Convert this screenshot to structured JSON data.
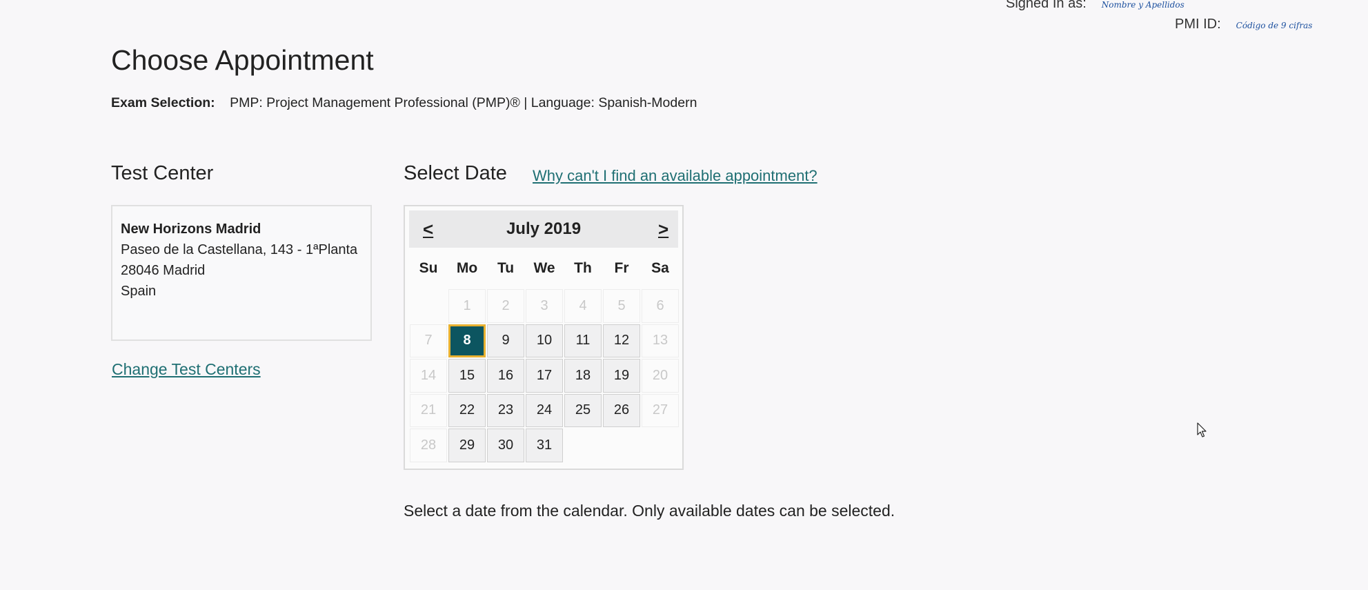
{
  "header": {
    "signed_in_label": "Signed In as:",
    "signed_in_value": "Nombre y Apellidos",
    "pmi_label": "PMI ID:",
    "pmi_value": "Código de 9 cifras"
  },
  "page_title": "Choose Appointment",
  "exam": {
    "label": "Exam Selection:",
    "value": "PMP: Project Management Professional (PMP)® | Language: Spanish-Modern"
  },
  "test_center": {
    "title": "Test Center",
    "name": "New Horizons Madrid",
    "address_line1": "Paseo de la Castellana, 143 - 1ªPlanta",
    "address_line2": "28046 Madrid",
    "country": "Spain",
    "change_link": "Change Test Centers"
  },
  "select_date": {
    "title": "Select Date",
    "help_link": "Why can't I find an available appointment?"
  },
  "calendar": {
    "prev": "<",
    "next": ">",
    "month_label": "July 2019",
    "weekdays": [
      "Su",
      "Mo",
      "Tu",
      "We",
      "Th",
      "Fr",
      "Sa"
    ],
    "selected_day": "8",
    "days": [
      {
        "label": "",
        "state": "empty"
      },
      {
        "label": "1",
        "state": "disabled"
      },
      {
        "label": "2",
        "state": "disabled"
      },
      {
        "label": "3",
        "state": "disabled"
      },
      {
        "label": "4",
        "state": "disabled"
      },
      {
        "label": "5",
        "state": "disabled"
      },
      {
        "label": "6",
        "state": "disabled"
      },
      {
        "label": "7",
        "state": "disabled"
      },
      {
        "label": "8",
        "state": "selected"
      },
      {
        "label": "9",
        "state": "available"
      },
      {
        "label": "10",
        "state": "available"
      },
      {
        "label": "11",
        "state": "available"
      },
      {
        "label": "12",
        "state": "available"
      },
      {
        "label": "13",
        "state": "disabled"
      },
      {
        "label": "14",
        "state": "disabled"
      },
      {
        "label": "15",
        "state": "available"
      },
      {
        "label": "16",
        "state": "available"
      },
      {
        "label": "17",
        "state": "available"
      },
      {
        "label": "18",
        "state": "available"
      },
      {
        "label": "19",
        "state": "available"
      },
      {
        "label": "20",
        "state": "disabled"
      },
      {
        "label": "21",
        "state": "disabled"
      },
      {
        "label": "22",
        "state": "available"
      },
      {
        "label": "23",
        "state": "available"
      },
      {
        "label": "24",
        "state": "available"
      },
      {
        "label": "25",
        "state": "available"
      },
      {
        "label": "26",
        "state": "available"
      },
      {
        "label": "27",
        "state": "disabled"
      },
      {
        "label": "28",
        "state": "disabled"
      },
      {
        "label": "29",
        "state": "available"
      },
      {
        "label": "30",
        "state": "available"
      },
      {
        "label": "31",
        "state": "available"
      }
    ]
  },
  "instructions": "Select a date from the calendar. Only available dates can be selected.",
  "colors": {
    "link": "#1f6f73",
    "selected_bg": "#0c5560",
    "selected_border": "#e8b130",
    "signature_ink": "#1b4f9e"
  },
  "icons": {
    "cursor": "mouse-pointer-icon"
  }
}
